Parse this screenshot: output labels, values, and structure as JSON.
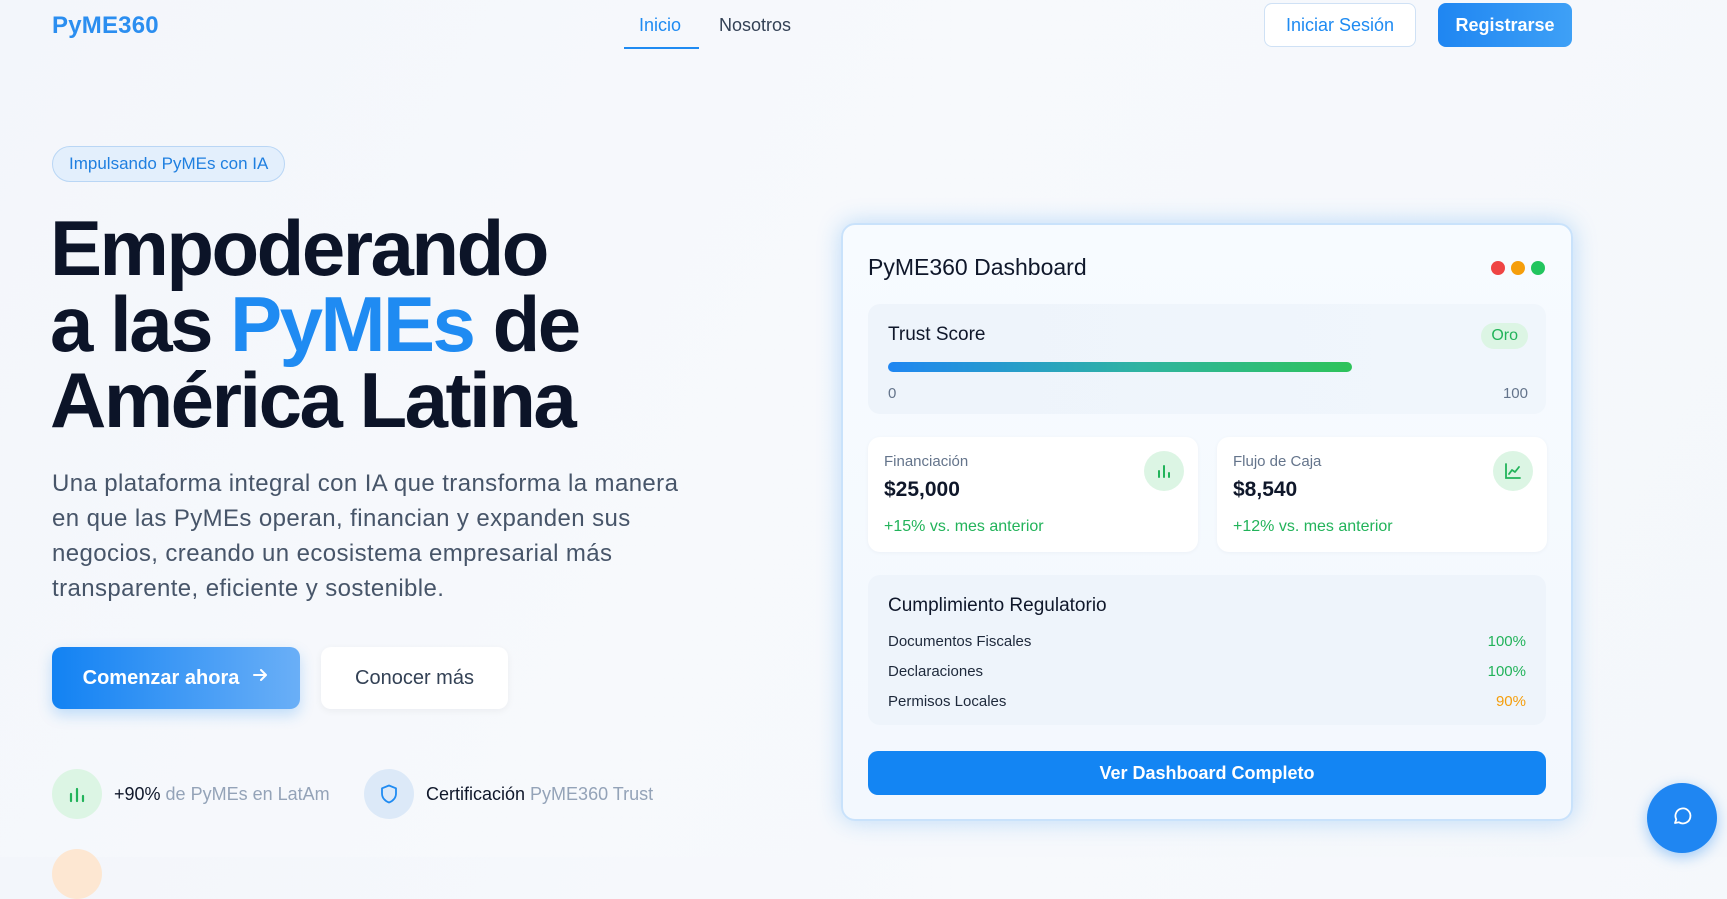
{
  "nav": {
    "logo": "PyME360",
    "links": [
      {
        "label": "Inicio",
        "active": true
      },
      {
        "label": "Nosotros",
        "active": false
      }
    ],
    "login_label": "Iniciar Sesión",
    "register_label": "Registrarse"
  },
  "hero": {
    "pill": "Impulsando PyMEs con IA",
    "headline": {
      "line1": "Empoderando",
      "line2_pre": "a las ",
      "line2_accent": "PyMEs",
      "line2_post": " de",
      "line3": "América Latina"
    },
    "subtext": "Una plataforma integral con IA que transforma la manera en que las PyMEs operan, financian y expanden sus negocios, creando un ecosistema empresarial más transparente, eficiente y sostenible.",
    "primary_cta": "Comenzar ahora",
    "secondary_cta": "Conocer más",
    "stats": [
      {
        "strong": "+90%",
        "rest": " de PyMEs en LatAm",
        "icon": "bar-chart-icon"
      },
      {
        "strong": "Certificación",
        "rest": " PyME360 Trust",
        "icon": "shield-icon"
      }
    ]
  },
  "dashboard": {
    "title": "PyME360 Dashboard",
    "window_dots": [
      "#ef4444",
      "#f59e0b",
      "#22c55e"
    ],
    "trust": {
      "label": "Trust Score",
      "badge": "Oro",
      "value_fraction": 0.725,
      "min": "0",
      "max": "100"
    },
    "metrics": [
      {
        "label": "Financiación",
        "value": "$25,000",
        "change": "+15% vs. mes anterior",
        "icon": "bar-chart-icon"
      },
      {
        "label": "Flujo de Caja",
        "value": "$8,540",
        "change": "+12% vs. mes anterior",
        "icon": "line-chart-icon"
      }
    ],
    "compliance": {
      "title": "Cumplimiento Regulatorio",
      "rows": [
        {
          "label": "Documentos Fiscales",
          "pct": "100%",
          "color": "#22b35a"
        },
        {
          "label": "Declaraciones",
          "pct": "100%",
          "color": "#22b35a"
        },
        {
          "label": "Permisos Locales",
          "pct": "90%",
          "color": "#f59e0b"
        }
      ]
    },
    "cta": "Ver Dashboard Completo"
  },
  "colors": {
    "accent": "#1f8bf2",
    "success": "#22b35a",
    "warning": "#f59e0b",
    "heading": "#0c1428"
  }
}
